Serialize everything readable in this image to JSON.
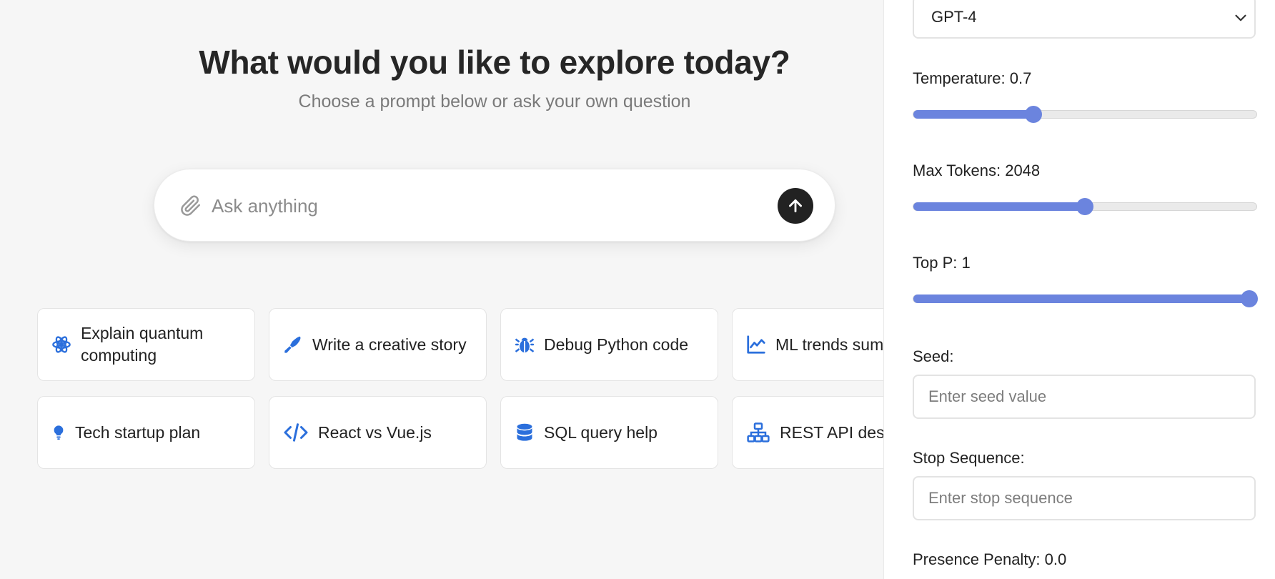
{
  "hero": {
    "title": "What would you like to explore today?",
    "subtitle": "Choose a prompt below or ask your own question"
  },
  "search": {
    "placeholder": "Ask anything",
    "value": ""
  },
  "prompt_cards": [
    {
      "label": "Explain quantum computing",
      "icon": "atom-icon"
    },
    {
      "label": "Write a creative story",
      "icon": "pen-icon"
    },
    {
      "label": "Debug Python code",
      "icon": "bug-icon"
    },
    {
      "label": "ML trends summary",
      "icon": "chart-line-icon"
    },
    {
      "label": "Tech startup plan",
      "icon": "lightbulb-icon"
    },
    {
      "label": "React vs Vue.js",
      "icon": "code-icon"
    },
    {
      "label": "SQL query help",
      "icon": "database-icon"
    },
    {
      "label": "REST API design",
      "icon": "sitemap-icon"
    }
  ],
  "settings": {
    "model": {
      "selected": "GPT-4"
    },
    "temperature": {
      "label": "Temperature: 0.7",
      "value": 0.7,
      "min": 0,
      "max": 2
    },
    "max_tokens": {
      "label": "Max Tokens: 2048",
      "value": 2048,
      "min": 1,
      "max": 4096
    },
    "top_p": {
      "label": "Top P: 1",
      "value": 1,
      "min": 0,
      "max": 1
    },
    "seed": {
      "label": "Seed:",
      "placeholder": "Enter seed value",
      "value": ""
    },
    "stop_sequence": {
      "label": "Stop Sequence:",
      "placeholder": "Enter stop sequence",
      "value": ""
    },
    "presence_penalty": {
      "label": "Presence Penalty: 0.0"
    }
  },
  "colors": {
    "accent": "#6b84de",
    "icon_blue": "#2b6fdc",
    "send_button": "#222222"
  }
}
